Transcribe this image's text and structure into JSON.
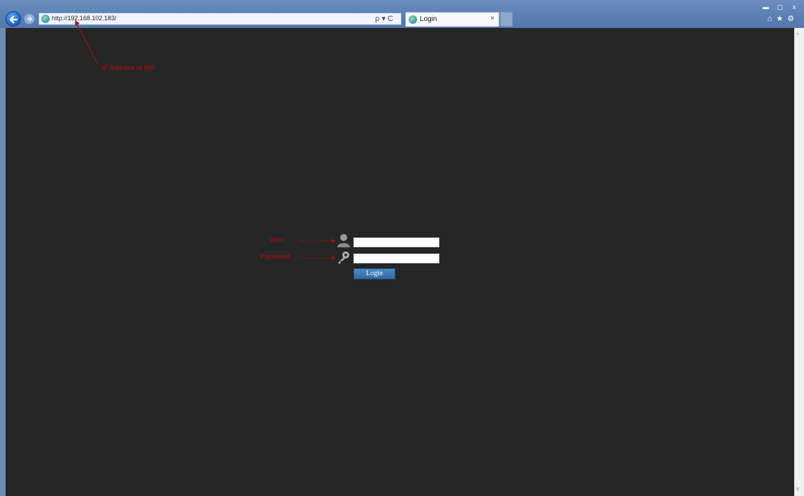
{
  "browser": {
    "url_prefix": "http://",
    "url_host": "192.168.102.183/",
    "addr_actions": "ρ ▾ C",
    "tab_title": "Login",
    "tab_close": "×",
    "win_minimize": "▬",
    "win_restore": "▢",
    "win_close": "x",
    "chrome_icons": "⌂★⚙"
  },
  "annotations": {
    "ip": "IP Address of NVI",
    "user": "User",
    "password": "Password"
  },
  "login": {
    "username_value": "",
    "password_value": "",
    "button_label": "Login"
  },
  "scrollbar": {
    "up": "^",
    "down": "v"
  },
  "colors": {
    "page_bg": "#262626",
    "annotation": "#a01010",
    "login_button": "#3a78b2"
  }
}
